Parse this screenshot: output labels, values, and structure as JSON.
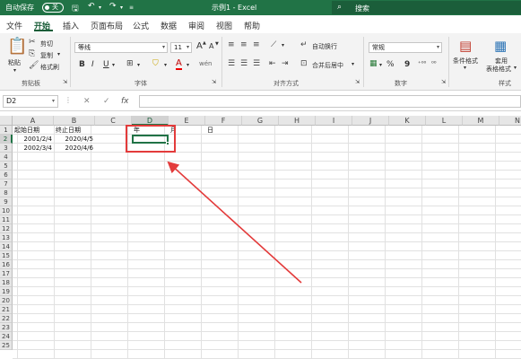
{
  "titlebar": {
    "autosave_label": "自动保存",
    "autosave_state": "关",
    "document_title": "示例1  -  Excel",
    "search_placeholder": "搜索"
  },
  "tabs": [
    "文件",
    "开始",
    "插入",
    "页面布局",
    "公式",
    "数据",
    "审阅",
    "视图",
    "帮助"
  ],
  "active_tab": "开始",
  "ribbon": {
    "clipboard": {
      "paste": "粘贴",
      "cut": "剪切",
      "copy": "复制",
      "format_painter": "格式刷",
      "group_label": "剪贴板"
    },
    "font": {
      "font_name": "等线",
      "font_size": "11",
      "grow": "A",
      "shrink": "A",
      "bold": "B",
      "italic": "I",
      "underline": "U",
      "font_color_letter": "A",
      "group_label": "字体"
    },
    "alignment": {
      "wrap_text": "自动换行",
      "merge_center": "合并后居中",
      "group_label": "对齐方式"
    },
    "number": {
      "format": "常规",
      "percent": "%",
      "comma": "9",
      "group_label": "数字"
    },
    "styles": {
      "conditional_formatting": "条件格式",
      "format_as_table": "套用",
      "format_as_table_2": "表格格式",
      "group_label": "样式"
    }
  },
  "formula_bar": {
    "name_box": "D2",
    "cancel": "✕",
    "enter": "✓",
    "fx": "fx",
    "content": ""
  },
  "columns": [
    "A",
    "B",
    "C",
    "D",
    "E",
    "F",
    "G",
    "H",
    "I",
    "J",
    "K",
    "L",
    "M",
    "N"
  ],
  "rows": [
    "1",
    "2",
    "3",
    "4",
    "5",
    "6",
    "7",
    "8",
    "9",
    "10",
    "11",
    "12",
    "13",
    "14",
    "15",
    "16",
    "17",
    "18",
    "19",
    "20",
    "21",
    "22",
    "23",
    "24",
    "25"
  ],
  "selected_cell": "D2",
  "cells": {
    "A1": "起始日期",
    "B1": "终止日期",
    "D1": "年",
    "E1": "月",
    "F1": "日",
    "A2": "2001/2/4",
    "B2": "2020/4/5",
    "A3": "2002/3/4",
    "B3": "2020/4/6"
  },
  "annotation_color": "#e33b3b",
  "accent_color": "#217346"
}
